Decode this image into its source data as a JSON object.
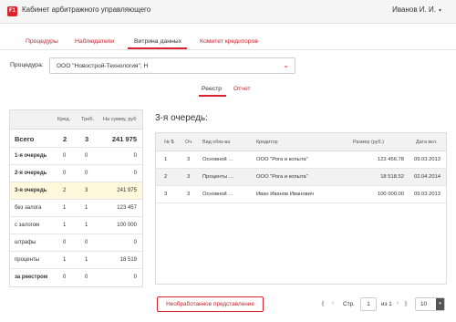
{
  "app": {
    "logo_text": "F1",
    "title": "Кабинет арбитражного управляющего",
    "user_name": "Иванов И. И.",
    "user_chevron": "▾"
  },
  "main_tabs": [
    {
      "label": "Процедуры",
      "active": false
    },
    {
      "label": "Наблюдатели",
      "active": false
    },
    {
      "label": "Витрина данных",
      "active": true
    },
    {
      "label": "Комитет кредиторов",
      "active": false
    }
  ],
  "procedure": {
    "label": "Процедура:",
    "value": "ООО \"Новострой-Технология\", Н",
    "chevron": "⌄"
  },
  "sub_tabs": [
    {
      "label": "Реестр",
      "active": true
    },
    {
      "label": "Отчет",
      "active": false
    }
  ],
  "summary": {
    "headers": {
      "cred": "Кред.",
      "claims": "Треб.",
      "sum": "На сумму, руб"
    },
    "total": {
      "label": "Всего",
      "cred": "2",
      "claims": "3",
      "sum": "241 975"
    },
    "rows": [
      {
        "label": "1-я очередь",
        "cred": "0",
        "claims": "0",
        "sum": "0",
        "bold": true,
        "highlight": false
      },
      {
        "label": "2-я очередь",
        "cred": "0",
        "claims": "0",
        "sum": "0",
        "bold": true,
        "highlight": false
      },
      {
        "label": "3-я очередь",
        "cred": "2",
        "claims": "3",
        "sum": "241 975",
        "bold": true,
        "highlight": true
      },
      {
        "label": "без залога",
        "cred": "1",
        "claims": "1",
        "sum": "123 457",
        "bold": false,
        "highlight": false
      },
      {
        "label": "с залогом",
        "cred": "1",
        "claims": "1",
        "sum": "100 000",
        "bold": false,
        "highlight": false
      },
      {
        "label": "штрафы",
        "cred": "0",
        "claims": "0",
        "sum": "0",
        "bold": false,
        "highlight": false
      },
      {
        "label": "проценты",
        "cred": "1",
        "claims": "1",
        "sum": "18 519",
        "bold": false,
        "highlight": false
      },
      {
        "label": "за реестром",
        "cred": "0",
        "claims": "0",
        "sum": "0",
        "bold": true,
        "highlight": false
      }
    ]
  },
  "queue_title": "3-я очередь:",
  "grid": {
    "headers": {
      "num": "№",
      "sort_icon": "⇅",
      "queue": "Оч.",
      "type": "Вид обяз-ва",
      "creditor": "Кредитор",
      "amount": "Размер (руб.)",
      "date": "Дата вкл."
    },
    "rows": [
      {
        "num": "1",
        "queue": "3",
        "type": "Основной …",
        "creditor": "ООО \"Рога и копыта\"",
        "amount": "123 456.78",
        "date": "09.03.2013"
      },
      {
        "num": "2",
        "queue": "3",
        "type": "Проценты …",
        "creditor": "ООО \"Рога и копыта\"",
        "amount": "18 518.52",
        "date": "02.04.2014"
      },
      {
        "num": "3",
        "queue": "3",
        "type": "Основной …",
        "creditor": "Иван Иванов Иванович",
        "amount": "100 000.00",
        "date": "09.03.2013"
      }
    ]
  },
  "raw_button": "Необработанное представление",
  "pager": {
    "first": "⟪",
    "prev": "‹",
    "page_label": "Стр.",
    "page": "1",
    "of_label": "из 1",
    "next": "›",
    "last": "⟫",
    "page_size": "10",
    "size_chevron": "▾"
  }
}
